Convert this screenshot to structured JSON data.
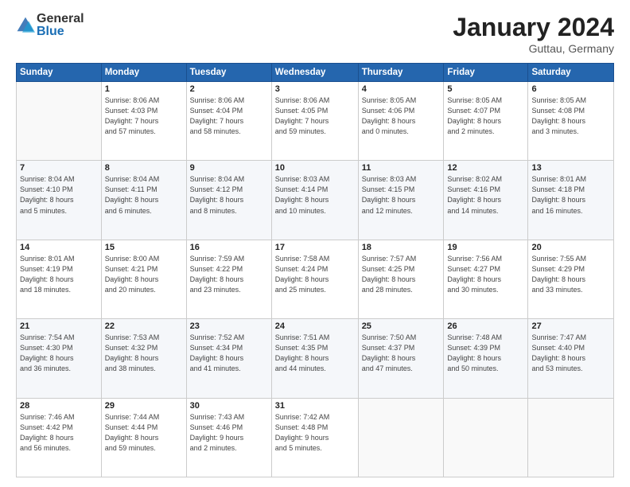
{
  "logo": {
    "general": "General",
    "blue": "Blue"
  },
  "title": "January 2024",
  "location": "Guttau, Germany",
  "days_header": [
    "Sunday",
    "Monday",
    "Tuesday",
    "Wednesday",
    "Thursday",
    "Friday",
    "Saturday"
  ],
  "weeks": [
    [
      {
        "day": "",
        "info": ""
      },
      {
        "day": "1",
        "info": "Sunrise: 8:06 AM\nSunset: 4:03 PM\nDaylight: 7 hours\nand 57 minutes."
      },
      {
        "day": "2",
        "info": "Sunrise: 8:06 AM\nSunset: 4:04 PM\nDaylight: 7 hours\nand 58 minutes."
      },
      {
        "day": "3",
        "info": "Sunrise: 8:06 AM\nSunset: 4:05 PM\nDaylight: 7 hours\nand 59 minutes."
      },
      {
        "day": "4",
        "info": "Sunrise: 8:05 AM\nSunset: 4:06 PM\nDaylight: 8 hours\nand 0 minutes."
      },
      {
        "day": "5",
        "info": "Sunrise: 8:05 AM\nSunset: 4:07 PM\nDaylight: 8 hours\nand 2 minutes."
      },
      {
        "day": "6",
        "info": "Sunrise: 8:05 AM\nSunset: 4:08 PM\nDaylight: 8 hours\nand 3 minutes."
      }
    ],
    [
      {
        "day": "7",
        "info": "Sunrise: 8:04 AM\nSunset: 4:10 PM\nDaylight: 8 hours\nand 5 minutes."
      },
      {
        "day": "8",
        "info": "Sunrise: 8:04 AM\nSunset: 4:11 PM\nDaylight: 8 hours\nand 6 minutes."
      },
      {
        "day": "9",
        "info": "Sunrise: 8:04 AM\nSunset: 4:12 PM\nDaylight: 8 hours\nand 8 minutes."
      },
      {
        "day": "10",
        "info": "Sunrise: 8:03 AM\nSunset: 4:14 PM\nDaylight: 8 hours\nand 10 minutes."
      },
      {
        "day": "11",
        "info": "Sunrise: 8:03 AM\nSunset: 4:15 PM\nDaylight: 8 hours\nand 12 minutes."
      },
      {
        "day": "12",
        "info": "Sunrise: 8:02 AM\nSunset: 4:16 PM\nDaylight: 8 hours\nand 14 minutes."
      },
      {
        "day": "13",
        "info": "Sunrise: 8:01 AM\nSunset: 4:18 PM\nDaylight: 8 hours\nand 16 minutes."
      }
    ],
    [
      {
        "day": "14",
        "info": "Sunrise: 8:01 AM\nSunset: 4:19 PM\nDaylight: 8 hours\nand 18 minutes."
      },
      {
        "day": "15",
        "info": "Sunrise: 8:00 AM\nSunset: 4:21 PM\nDaylight: 8 hours\nand 20 minutes."
      },
      {
        "day": "16",
        "info": "Sunrise: 7:59 AM\nSunset: 4:22 PM\nDaylight: 8 hours\nand 23 minutes."
      },
      {
        "day": "17",
        "info": "Sunrise: 7:58 AM\nSunset: 4:24 PM\nDaylight: 8 hours\nand 25 minutes."
      },
      {
        "day": "18",
        "info": "Sunrise: 7:57 AM\nSunset: 4:25 PM\nDaylight: 8 hours\nand 28 minutes."
      },
      {
        "day": "19",
        "info": "Sunrise: 7:56 AM\nSunset: 4:27 PM\nDaylight: 8 hours\nand 30 minutes."
      },
      {
        "day": "20",
        "info": "Sunrise: 7:55 AM\nSunset: 4:29 PM\nDaylight: 8 hours\nand 33 minutes."
      }
    ],
    [
      {
        "day": "21",
        "info": "Sunrise: 7:54 AM\nSunset: 4:30 PM\nDaylight: 8 hours\nand 36 minutes."
      },
      {
        "day": "22",
        "info": "Sunrise: 7:53 AM\nSunset: 4:32 PM\nDaylight: 8 hours\nand 38 minutes."
      },
      {
        "day": "23",
        "info": "Sunrise: 7:52 AM\nSunset: 4:34 PM\nDaylight: 8 hours\nand 41 minutes."
      },
      {
        "day": "24",
        "info": "Sunrise: 7:51 AM\nSunset: 4:35 PM\nDaylight: 8 hours\nand 44 minutes."
      },
      {
        "day": "25",
        "info": "Sunrise: 7:50 AM\nSunset: 4:37 PM\nDaylight: 8 hours\nand 47 minutes."
      },
      {
        "day": "26",
        "info": "Sunrise: 7:48 AM\nSunset: 4:39 PM\nDaylight: 8 hours\nand 50 minutes."
      },
      {
        "day": "27",
        "info": "Sunrise: 7:47 AM\nSunset: 4:40 PM\nDaylight: 8 hours\nand 53 minutes."
      }
    ],
    [
      {
        "day": "28",
        "info": "Sunrise: 7:46 AM\nSunset: 4:42 PM\nDaylight: 8 hours\nand 56 minutes."
      },
      {
        "day": "29",
        "info": "Sunrise: 7:44 AM\nSunset: 4:44 PM\nDaylight: 8 hours\nand 59 minutes."
      },
      {
        "day": "30",
        "info": "Sunrise: 7:43 AM\nSunset: 4:46 PM\nDaylight: 9 hours\nand 2 minutes."
      },
      {
        "day": "31",
        "info": "Sunrise: 7:42 AM\nSunset: 4:48 PM\nDaylight: 9 hours\nand 5 minutes."
      },
      {
        "day": "",
        "info": ""
      },
      {
        "day": "",
        "info": ""
      },
      {
        "day": "",
        "info": ""
      }
    ]
  ]
}
